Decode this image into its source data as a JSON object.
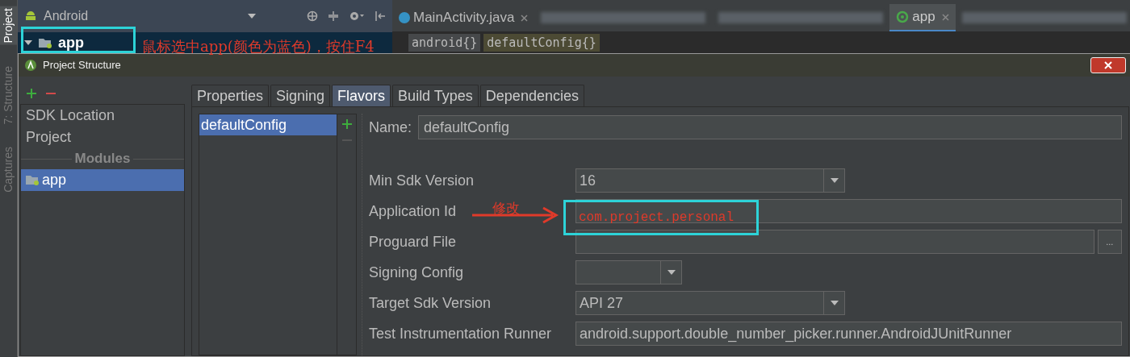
{
  "tool_strip": [
    {
      "label": "Project",
      "selected": true
    },
    {
      "label": "7: Structure",
      "selected": false
    },
    {
      "label": "Captures",
      "selected": false
    }
  ],
  "project_panel": {
    "view": "Android",
    "tree": [
      {
        "label": "app",
        "selected": true
      }
    ]
  },
  "editor_tabs": [
    {
      "kind": "class",
      "label": "MainActivity.java",
      "selected": false
    },
    {
      "kind": "redacted",
      "selected": false
    },
    {
      "kind": "redacted",
      "selected": false
    },
    {
      "kind": "gradle",
      "label": "app",
      "selected": true
    },
    {
      "kind": "redacted",
      "selected": false
    }
  ],
  "breadcrumbs": [
    {
      "label": "android{}",
      "kind": "block"
    },
    {
      "label": "defaultConfig{}",
      "kind": "current"
    }
  ],
  "annotations": [
    {
      "kind": "note",
      "text": "鼠标选中app(颜色为蓝色)，按住F4"
    },
    {
      "kind": "arrow",
      "text": "修改"
    },
    {
      "kind": "value",
      "text": "com.project.personal"
    }
  ],
  "dialog": {
    "title": "Project Structure",
    "sidebar": {
      "items": [
        {
          "label": "SDK Location",
          "selected": false
        },
        {
          "label": "Project",
          "selected": false
        }
      ],
      "section": "Modules",
      "modules": [
        {
          "label": "app",
          "selected": true
        }
      ]
    },
    "tabs": [
      {
        "label": "Properties",
        "selected": false
      },
      {
        "label": "Signing",
        "selected": false
      },
      {
        "label": "Flavors",
        "selected": true
      },
      {
        "label": "Build Types",
        "selected": false
      },
      {
        "label": "Dependencies",
        "selected": false
      }
    ],
    "flavors": [
      {
        "label": "defaultConfig",
        "selected": true
      }
    ],
    "form": {
      "name_label": "Name:",
      "name_value": "defaultConfig",
      "fields": [
        {
          "kind": "combo",
          "label": "Min Sdk Version",
          "value": "16"
        },
        {
          "kind": "text",
          "label": "Application Id"
        },
        {
          "kind": "file",
          "label": "Proguard File",
          "button": "..."
        },
        {
          "kind": "combo_short",
          "label": "Signing Config"
        },
        {
          "kind": "combo",
          "label": "Target Sdk Version",
          "value": "API 27"
        },
        {
          "kind": "text",
          "label": "Test Instrumentation Runner",
          "value": "android.support.double_number_picker.runner.AndroidJUnitRunner"
        }
      ]
    }
  }
}
